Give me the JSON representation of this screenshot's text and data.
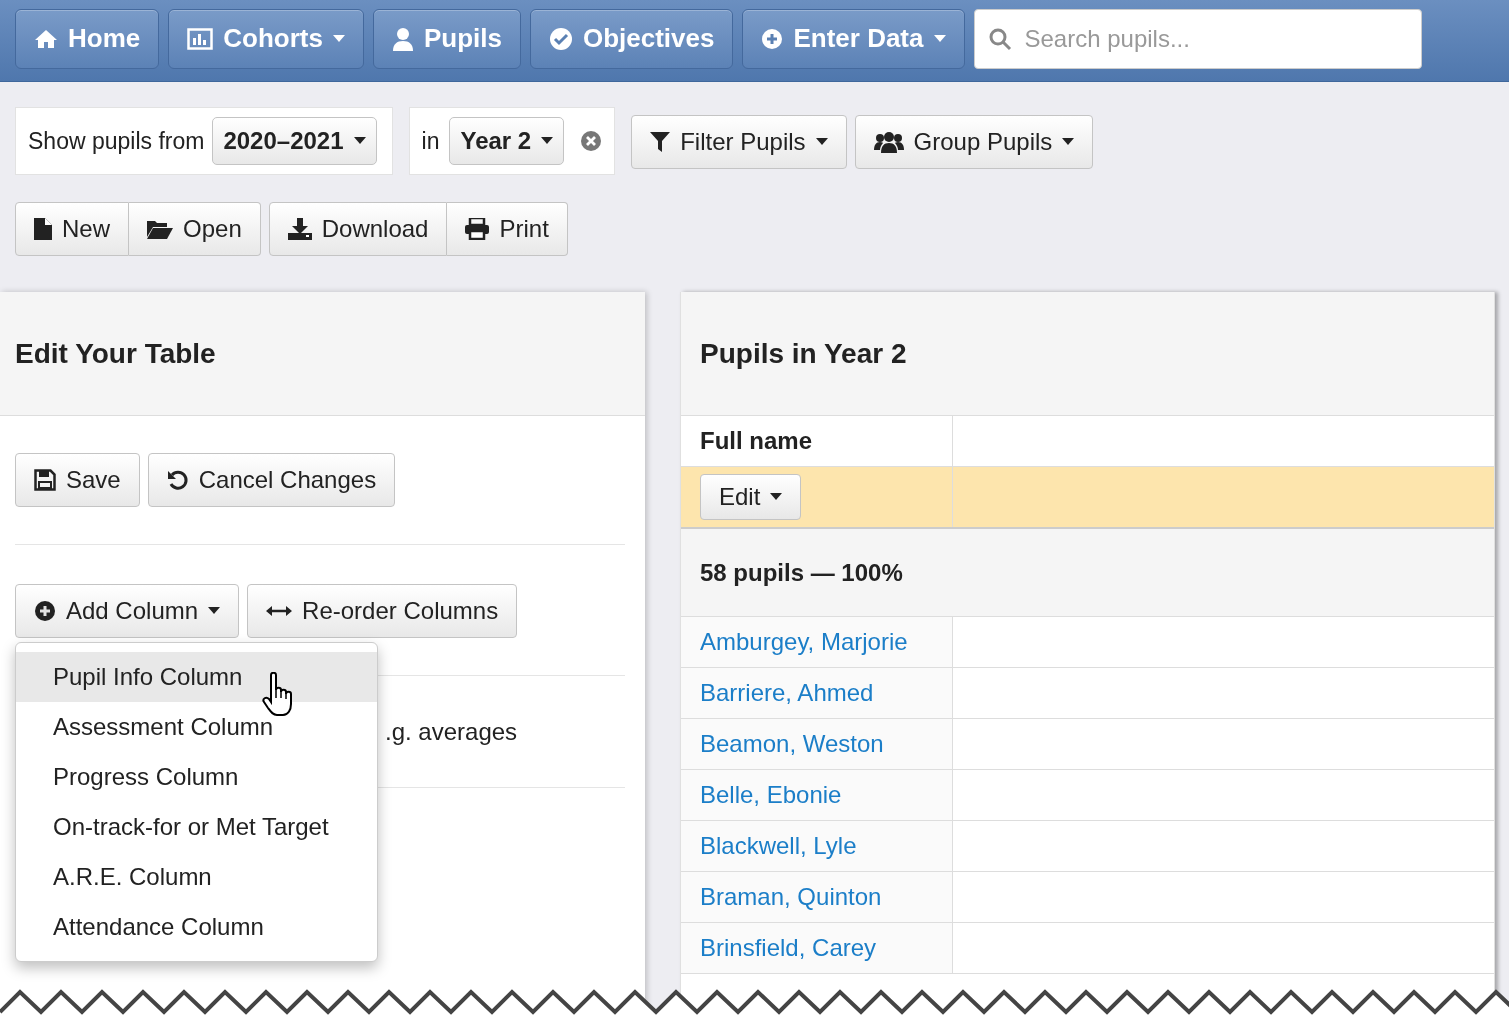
{
  "nav": [
    {
      "label": "Home",
      "has_menu": false
    },
    {
      "label": "Cohorts",
      "has_menu": true
    },
    {
      "label": "Pupils",
      "has_menu": false
    },
    {
      "label": "Objectives",
      "has_menu": false
    },
    {
      "label": "Enter Data",
      "has_menu": true
    }
  ],
  "search": {
    "placeholder": "Search pupils..."
  },
  "filters": {
    "prefix": "Show pupils from",
    "year": "2020–2021",
    "in_label": "in",
    "group": "Year 2"
  },
  "filter_buttons": [
    "Filter Pupils",
    "Group Pupils"
  ],
  "file_buttons": [
    [
      "New",
      "Open"
    ],
    [
      "Download",
      "Print"
    ]
  ],
  "edit_panel": {
    "title": "Edit Your Table",
    "buttons": [
      "Save",
      "Cancel Changes"
    ],
    "column_buttons": [
      "Add Column",
      "Re-order Columns"
    ],
    "hidden_text": ".g. averages",
    "menu": [
      {
        "label": "Pupil Info Column",
        "highlighted": true
      },
      {
        "label": "Assessment Column",
        "highlighted": false
      },
      {
        "label": "Progress Column",
        "highlighted": false
      },
      {
        "label": "On-track-for or Met Target",
        "highlighted": false
      },
      {
        "label": "A.R.E. Column",
        "highlighted": false
      },
      {
        "label": "Attendance Column",
        "highlighted": false
      }
    ]
  },
  "pupils_panel": {
    "title": "Pupils in Year 2",
    "column": "Full name",
    "edit_button": "Edit",
    "summary": "58 pupils — 100%",
    "rows": [
      "Amburgey, Marjorie",
      "Barriere, Ahmed",
      "Beamon, Weston",
      "Belle, Ebonie",
      "Blackwell, Lyle",
      "Braman, Quinton",
      "Brinsfield, Carey"
    ]
  }
}
